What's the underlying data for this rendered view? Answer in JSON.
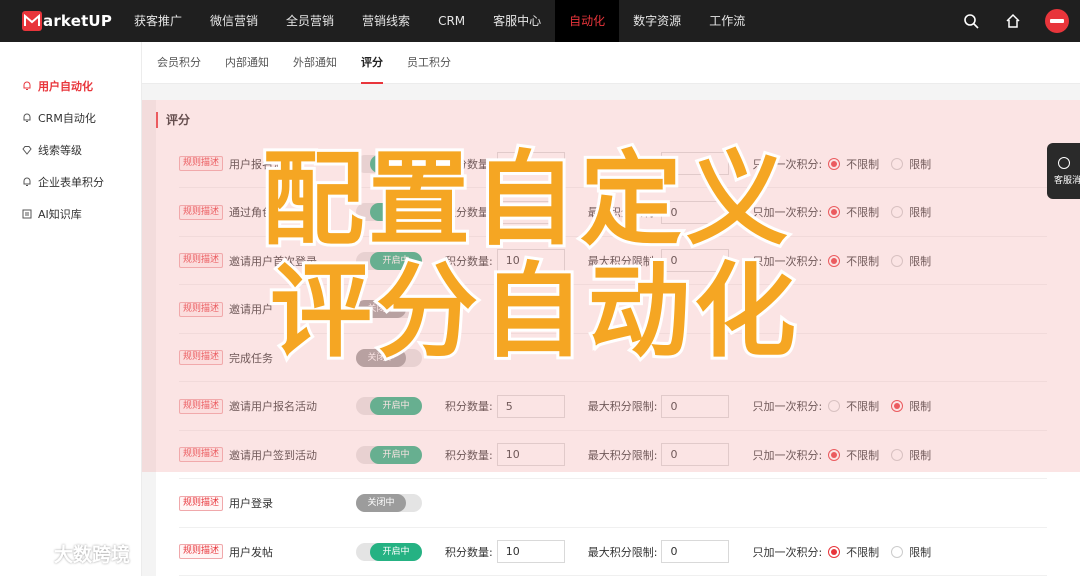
{
  "app": {
    "logo_text": "arketUP"
  },
  "topnav": {
    "items": [
      "获客推广",
      "微信营销",
      "全员营销",
      "营销线索",
      "CRM",
      "客服中心",
      "自动化",
      "数字资源",
      "工作流"
    ],
    "active_index": 6
  },
  "sidebar": {
    "items": [
      {
        "label": "用户自动化",
        "icon": "bell-icon",
        "active": true
      },
      {
        "label": "CRM自动化",
        "icon": "bell-icon",
        "active": false
      },
      {
        "label": "线索等级",
        "icon": "diamond-icon",
        "active": false
      },
      {
        "label": "企业表单积分",
        "icon": "bell-icon",
        "active": false
      },
      {
        "label": "AI知识库",
        "icon": "list-icon",
        "active": false
      }
    ]
  },
  "subtabs": {
    "items": [
      "会员积分",
      "内部通知",
      "外部通知",
      "评分",
      "员工积分"
    ],
    "active_index": 3
  },
  "section": {
    "title": "评分"
  },
  "labels": {
    "rule_tag": "规则描述",
    "points_qty": "积分数量:",
    "max_limit": "最大积分限制:",
    "once_only": "只加一次积分:",
    "unlimited": "不限制",
    "limited": "限制",
    "on": "开启中",
    "off": "关闭中"
  },
  "rules": [
    {
      "name": "用户报名活动",
      "enabled": true,
      "points": "40",
      "max": "0",
      "once": "unlimited"
    },
    {
      "name": "通过角色",
      "enabled": true,
      "points": "",
      "max": "0",
      "once": "unlimited"
    },
    {
      "name": "邀请用户首次登录",
      "enabled": true,
      "points": "10",
      "max": "0",
      "once": "unlimited"
    },
    {
      "name": "邀请用户",
      "enabled": false,
      "points": null,
      "max": null,
      "once": null
    },
    {
      "name": "完成任务",
      "enabled": false,
      "points": null,
      "max": null,
      "once": null
    },
    {
      "name": "邀请用户报名活动",
      "enabled": true,
      "points": "5",
      "max": "0",
      "once": "limited"
    },
    {
      "name": "邀请用户签到活动",
      "enabled": true,
      "points": "10",
      "max": "0",
      "once": "unlimited"
    },
    {
      "name": "用户登录",
      "enabled": false,
      "points": null,
      "max": null,
      "once": null
    },
    {
      "name": "用户发帖",
      "enabled": true,
      "points": "10",
      "max": "0",
      "once": "unlimited"
    }
  ],
  "kefu": {
    "label": "客服消"
  },
  "overlay": {
    "line1": "配置自定义",
    "line2": "评分自动化"
  },
  "watermark": {
    "text": "大数跨境"
  },
  "colors": {
    "accent": "#e8353b",
    "toggle_on": "#25b283",
    "caption": "#f5a623"
  }
}
